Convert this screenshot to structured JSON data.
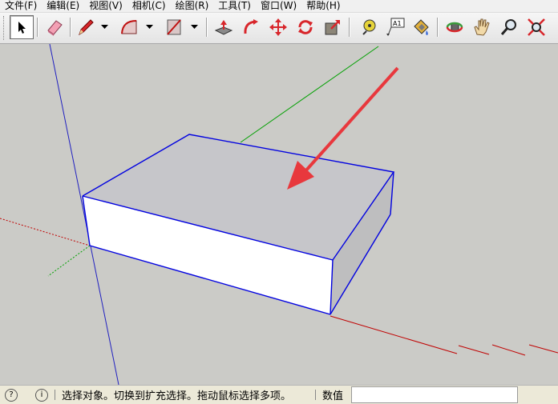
{
  "menu": [
    "文件(F)",
    "编辑(E)",
    "视图(V)",
    "相机(C)",
    "绘图(R)",
    "工具(T)",
    "窗口(W)",
    "帮助(H)"
  ],
  "toolbar": {
    "tools": [
      {
        "name": "select-tool",
        "icon": "arrow-cursor-icon",
        "selected": true
      },
      {
        "name": "eraser-tool",
        "icon": "eraser-icon"
      },
      {
        "name": "pencil-tool",
        "icon": "pencil-icon"
      },
      {
        "name": "arc-tool",
        "icon": "arc-icon"
      },
      {
        "name": "rectangle-tool",
        "icon": "rectangle-icon"
      },
      {
        "name": "push-pull-tool",
        "icon": "push-pull-icon"
      },
      {
        "name": "follow-me-tool",
        "icon": "follow-me-icon"
      },
      {
        "name": "move-tool",
        "icon": "move-arrows-icon"
      },
      {
        "name": "rotate-tool",
        "icon": "rotate-icon"
      },
      {
        "name": "scale-tool",
        "icon": "scale-icon"
      },
      {
        "name": "tape-measure-tool",
        "icon": "tape-measure-icon"
      },
      {
        "name": "text-tool",
        "icon": "text-icon",
        "text": "A1"
      },
      {
        "name": "paint-bucket-tool",
        "icon": "paint-bucket-icon"
      },
      {
        "name": "orbit-tool",
        "icon": "orbit-icon"
      },
      {
        "name": "pan-tool",
        "icon": "hand-icon"
      },
      {
        "name": "zoom-tool",
        "icon": "magnifier-icon"
      },
      {
        "name": "zoom-extents-tool",
        "icon": "zoom-extents-icon"
      }
    ]
  },
  "status": {
    "hint_text": "选择对象。切换到扩充选择。拖动鼠标选择多项。",
    "value_label": "数值",
    "value": ""
  },
  "colors": {
    "viewport_bg": "#cbcbc7",
    "edge_blue": "#0000e0",
    "annotation_red": "#e8383d",
    "axis_red": "#c00000",
    "axis_green": "#00a000",
    "axis_blue": "#2020c0"
  }
}
